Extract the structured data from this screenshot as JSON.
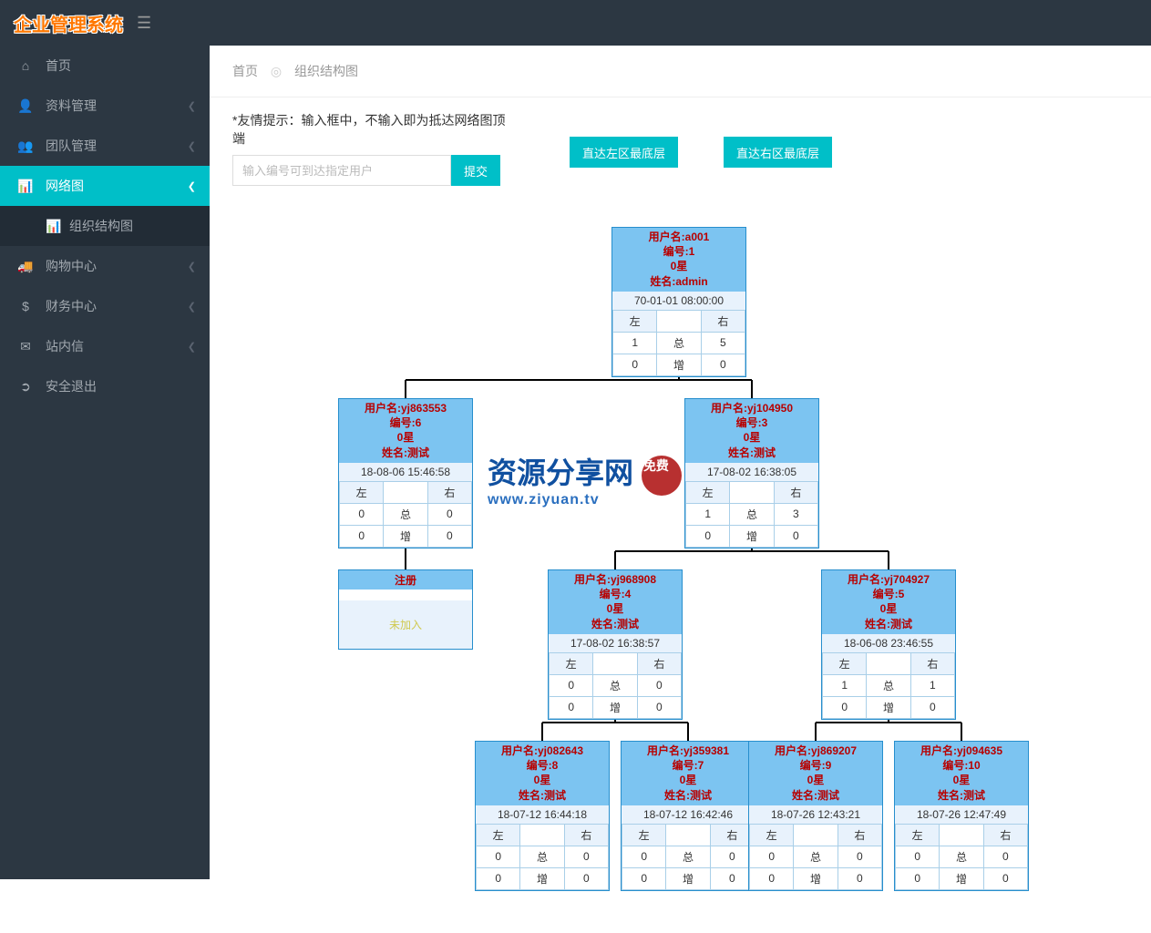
{
  "app": {
    "title": "企业管理系统"
  },
  "nav": {
    "home": "首页",
    "profile": "资料管理",
    "team": "团队管理",
    "network": "网络图",
    "org_chart": "组织结构图",
    "mall": "购物中心",
    "finance": "财务中心",
    "inbox": "站内信",
    "logout": "安全退出"
  },
  "breadcrumb": {
    "home": "首页",
    "current": "组织结构图"
  },
  "hint": "*友情提示：输入框中，不输入即为抵达网络图顶端",
  "search": {
    "placeholder": "输入编号可到达指定用户",
    "submit": "提交"
  },
  "buttons": {
    "left_bottom": "直达左区最底层",
    "right_bottom": "直达右区最底层"
  },
  "labels": {
    "left": "左",
    "right": "右",
    "total": "总",
    "inc": "增",
    "user": "用户名",
    "id": "编号",
    "star": "星",
    "name": "姓名",
    "register": "注册",
    "not_joined": "未加入"
  },
  "root": {
    "user": "a001",
    "id": "1",
    "star": "0",
    "name": "admin",
    "ts": "70-01-01 08:00:00",
    "l1": "1",
    "r1": "5",
    "l2": "0",
    "r2": "0"
  },
  "l": {
    "user": "yj863553",
    "id": "6",
    "star": "0",
    "name": "测试",
    "ts": "18-08-06 15:46:58",
    "l1": "0",
    "r1": "0",
    "l2": "0",
    "r2": "0"
  },
  "r": {
    "user": "yj104950",
    "id": "3",
    "star": "0",
    "name": "测试",
    "ts": "17-08-02 16:38:05",
    "l1": "1",
    "r1": "3",
    "l2": "0",
    "r2": "0"
  },
  "rl": {
    "user": "yj968908",
    "id": "4",
    "star": "0",
    "name": "测试",
    "ts": "17-08-02 16:38:57",
    "l1": "0",
    "r1": "0",
    "l2": "0",
    "r2": "0"
  },
  "rr": {
    "user": "yj704927",
    "id": "5",
    "star": "0",
    "name": "测试",
    "ts": "18-06-08 23:46:55",
    "l1": "1",
    "r1": "1",
    "l2": "0",
    "r2": "0"
  },
  "leaf1": {
    "user": "yj082643",
    "id": "8",
    "star": "0",
    "name": "测试",
    "ts": "18-07-12 16:44:18",
    "l1": "0",
    "r1": "0",
    "l2": "0",
    "r2": "0"
  },
  "leaf2": {
    "user": "yj359381",
    "id": "7",
    "star": "0",
    "name": "测试",
    "ts": "18-07-12 16:42:46",
    "l1": "0",
    "r1": "0",
    "l2": "0",
    "r2": "0"
  },
  "leaf3": {
    "user": "yj869207",
    "id": "9",
    "star": "0",
    "name": "测试",
    "ts": "18-07-26 12:43:21",
    "l1": "0",
    "r1": "0",
    "l2": "0",
    "r2": "0"
  },
  "leaf4": {
    "user": "yj094635",
    "id": "10",
    "star": "0",
    "name": "测试",
    "ts": "18-07-26 12:47:49",
    "l1": "0",
    "r1": "0",
    "l2": "0",
    "r2": "0"
  },
  "watermark": {
    "main": "资源分享网",
    "badge": "免费",
    "sub": "www.ziyuan.tv"
  }
}
